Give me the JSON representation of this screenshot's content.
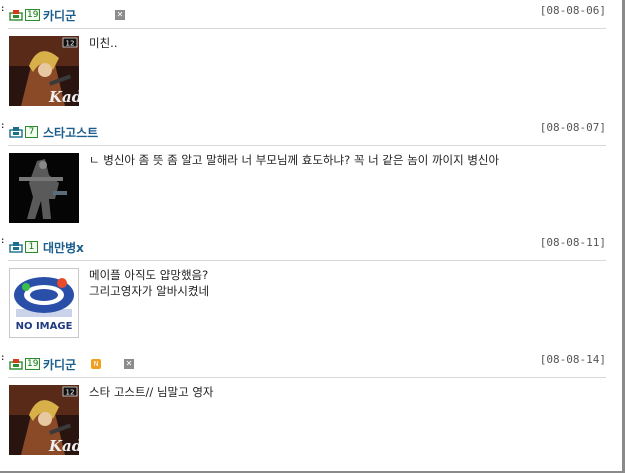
{
  "comments": [
    {
      "nickname": "카디군",
      "level": "19",
      "date": "[08-08-06]",
      "text": "미친..",
      "avatar": "kadi-avatar",
      "avatar_label": "Kadi",
      "avatar_age": "12",
      "delete_icon": "✕"
    },
    {
      "nickname": "스타고스트",
      "level": "7",
      "date": "[08-08-07]",
      "text": "ㄴ 병신아 좀 뜻 좀 알고 말해라 너 부모님께 효도하냐? 꼭 너 같은 놈이 까이지 병신아",
      "avatar": "ghost-avatar"
    },
    {
      "nickname": "대만병x",
      "level": "1",
      "date": "[08-08-11]",
      "text": "메이플 아직도 얍망했음?\n그리고영자가 알바시켰네",
      "avatar": "no-image-avatar",
      "no_image_label": "NO IMAGE"
    },
    {
      "nickname": "카디군",
      "level": "19",
      "date": "[08-08-14]",
      "text": "스타 고스트// 님말고 영자",
      "avatar": "kadi-avatar",
      "avatar_label": "Kadi",
      "avatar_age": "12",
      "new_badge": "N",
      "delete_icon": "✕"
    }
  ],
  "colors": {
    "nickname": "#1b5d8c",
    "level_border": "#2d8b2d",
    "divider": "#d8d8d8"
  }
}
